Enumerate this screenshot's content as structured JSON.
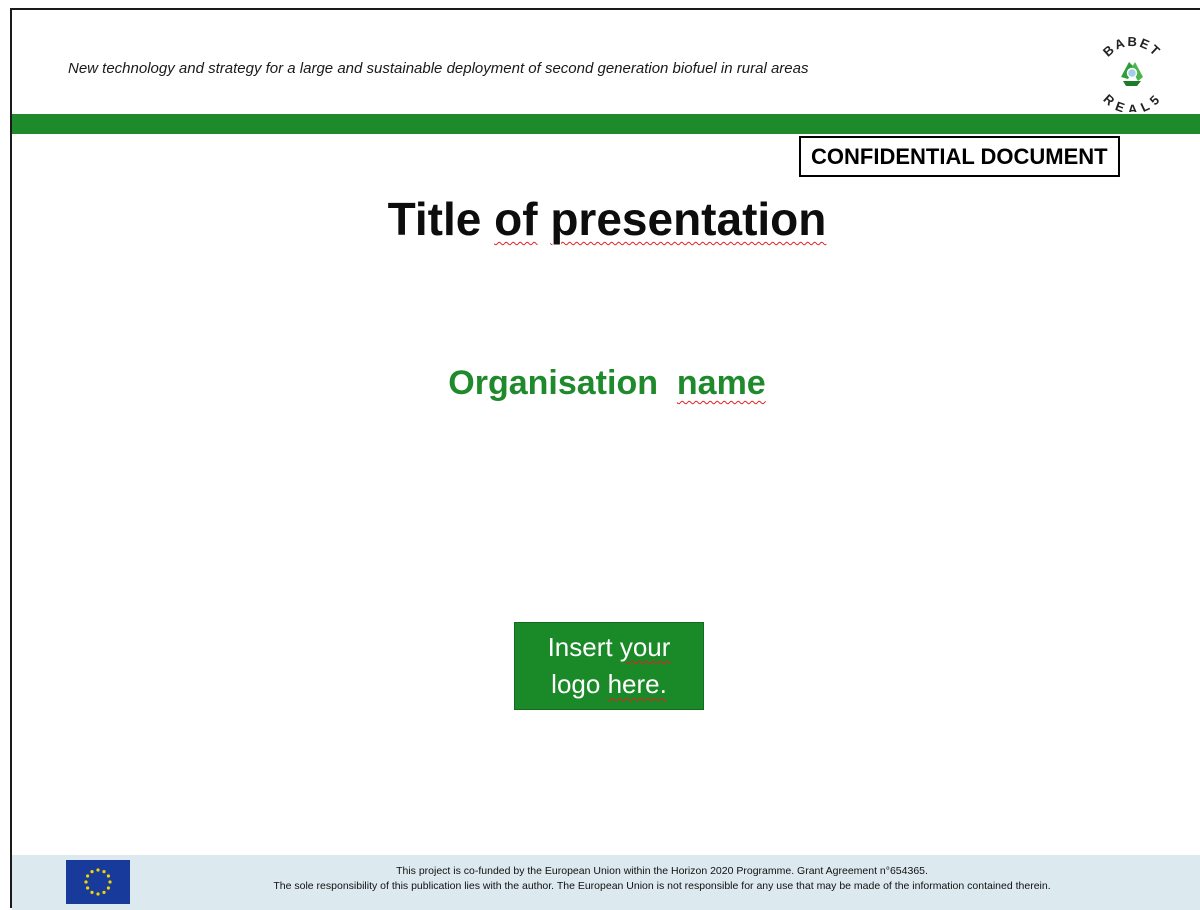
{
  "header": {
    "tagline": "New technology and strategy for a large and sustainable deployment of second generation biofuel in rural areas",
    "logo": {
      "top_text": "BABET",
      "bottom_text": "REAL5",
      "icon": "recycle-leaf-icon"
    },
    "accent_color": "#1f8a2c"
  },
  "badge": {
    "text": "CONFIDENTIAL DOCUMENT"
  },
  "main": {
    "title_word1": "Title",
    "title_word2": "of",
    "title_word3": "presentation",
    "organisation_word1": "Organisation",
    "organisation_word2": "name",
    "logo_placeholder": {
      "line1_a": "Insert",
      "line1_b": "your",
      "line2_a": "logo",
      "line2_b": "here."
    }
  },
  "footer": {
    "flag_icon": "eu-flag-icon",
    "line1": "This project is co-funded by the European Union within the Horizon 2020 Programme.  Grant Agreement n°654365.",
    "line2": "The sole responsibility of this publication lies with the author. The European Union is not responsible for any use that may be made of the information contained therein."
  }
}
